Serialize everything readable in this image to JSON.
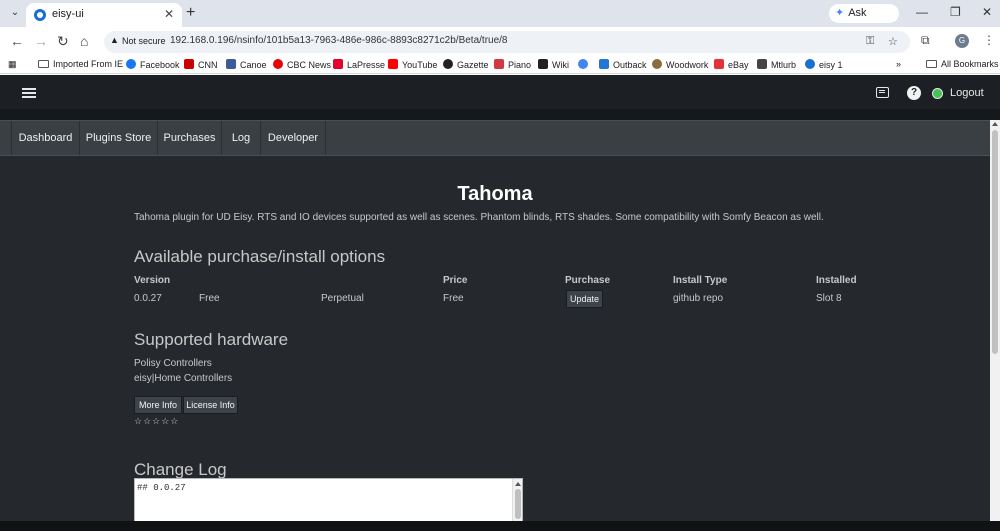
{
  "browser": {
    "tab_title": "eisy-ui",
    "tab_close": "✕",
    "new_tab": "+",
    "gemini_label": "Ask Gemini",
    "security_label": "Not secure",
    "url": "192.168.0.196/nsinfo/101b5a13-7963-486e-986c-8893c8271c2b/Beta/true/8",
    "profile_initial": "G",
    "bookmarks": [
      {
        "label": "Imported From IE",
        "icon": "folder-icon"
      },
      {
        "label": "Facebook",
        "icon": "facebook-icon",
        "color": "#1877f2"
      },
      {
        "label": "CNN",
        "icon": "cnn-icon",
        "color": "#cc0000"
      },
      {
        "label": "Canoe",
        "icon": "canoe-icon",
        "color": "#3b5b9a"
      },
      {
        "label": "CBC News",
        "icon": "cbc-icon",
        "color": "#e60505"
      },
      {
        "label": "LaPresse",
        "icon": "lapresse-icon",
        "color": "#e4002b"
      },
      {
        "label": "YouTube",
        "icon": "youtube-icon",
        "color": "#ff0000"
      },
      {
        "label": "Gazette",
        "icon": "gazette-icon",
        "color": "#222222"
      },
      {
        "label": "Piano",
        "icon": "piano-icon",
        "color": "#d4383f"
      },
      {
        "label": "Wiki",
        "icon": "wiki-icon",
        "color": "#222222"
      },
      {
        "label": "",
        "icon": "google-icon",
        "color": "#4285f4"
      },
      {
        "label": "Outback",
        "icon": "outback-icon",
        "color": "#2477d6"
      },
      {
        "label": "Woodwork",
        "icon": "woodwork-icon",
        "color": "#8a6d3b"
      },
      {
        "label": "eBay",
        "icon": "ebay-icon",
        "color": "#e53238"
      },
      {
        "label": "Mtlurb",
        "icon": "mtlurb-icon",
        "color": "#444444"
      },
      {
        "label": "eisy 1",
        "icon": "eisy-icon",
        "color": "#1a6fd1"
      }
    ],
    "all_bookmarks": "All Bookmarks"
  },
  "app": {
    "logout_label": "Logout",
    "nav": [
      "Dashboard",
      "Plugins Store",
      "Purchases",
      "Log",
      "Developer"
    ],
    "title": "Tahoma",
    "description": "Tahoma plugin for UD Eisy. RTS and IO devices supported as well as scenes. Phantom blinds, RTS shades. Some compatibility with Somfy Beacon as well.",
    "options_heading": "Available purchase/install options",
    "table": {
      "headers": {
        "version": "Version",
        "price": "Price",
        "purchase": "Purchase",
        "install_type": "Install Type",
        "installed": "Installed"
      },
      "row": {
        "version": "0.0.27",
        "free": "Free",
        "license": "Perpetual",
        "price": "Free",
        "purchase_button": "Update",
        "install_type": "github repo",
        "installed": "Slot 8"
      }
    },
    "hardware_heading": "Supported hardware",
    "hardware": [
      "Polisy Controllers",
      "eisy|Home Controllers"
    ],
    "more_info_button": "More Info",
    "license_info_button": "License Info",
    "rating": "☆☆☆☆☆",
    "changelog_heading": "Change Log",
    "changelog_lines": [
      "## 0.0.27"
    ]
  },
  "colors": {
    "app_bg": "#25292e",
    "topbar_bg": "#1c2024",
    "subnav_bg": "#3a3f44",
    "status_online": "#45c354"
  }
}
